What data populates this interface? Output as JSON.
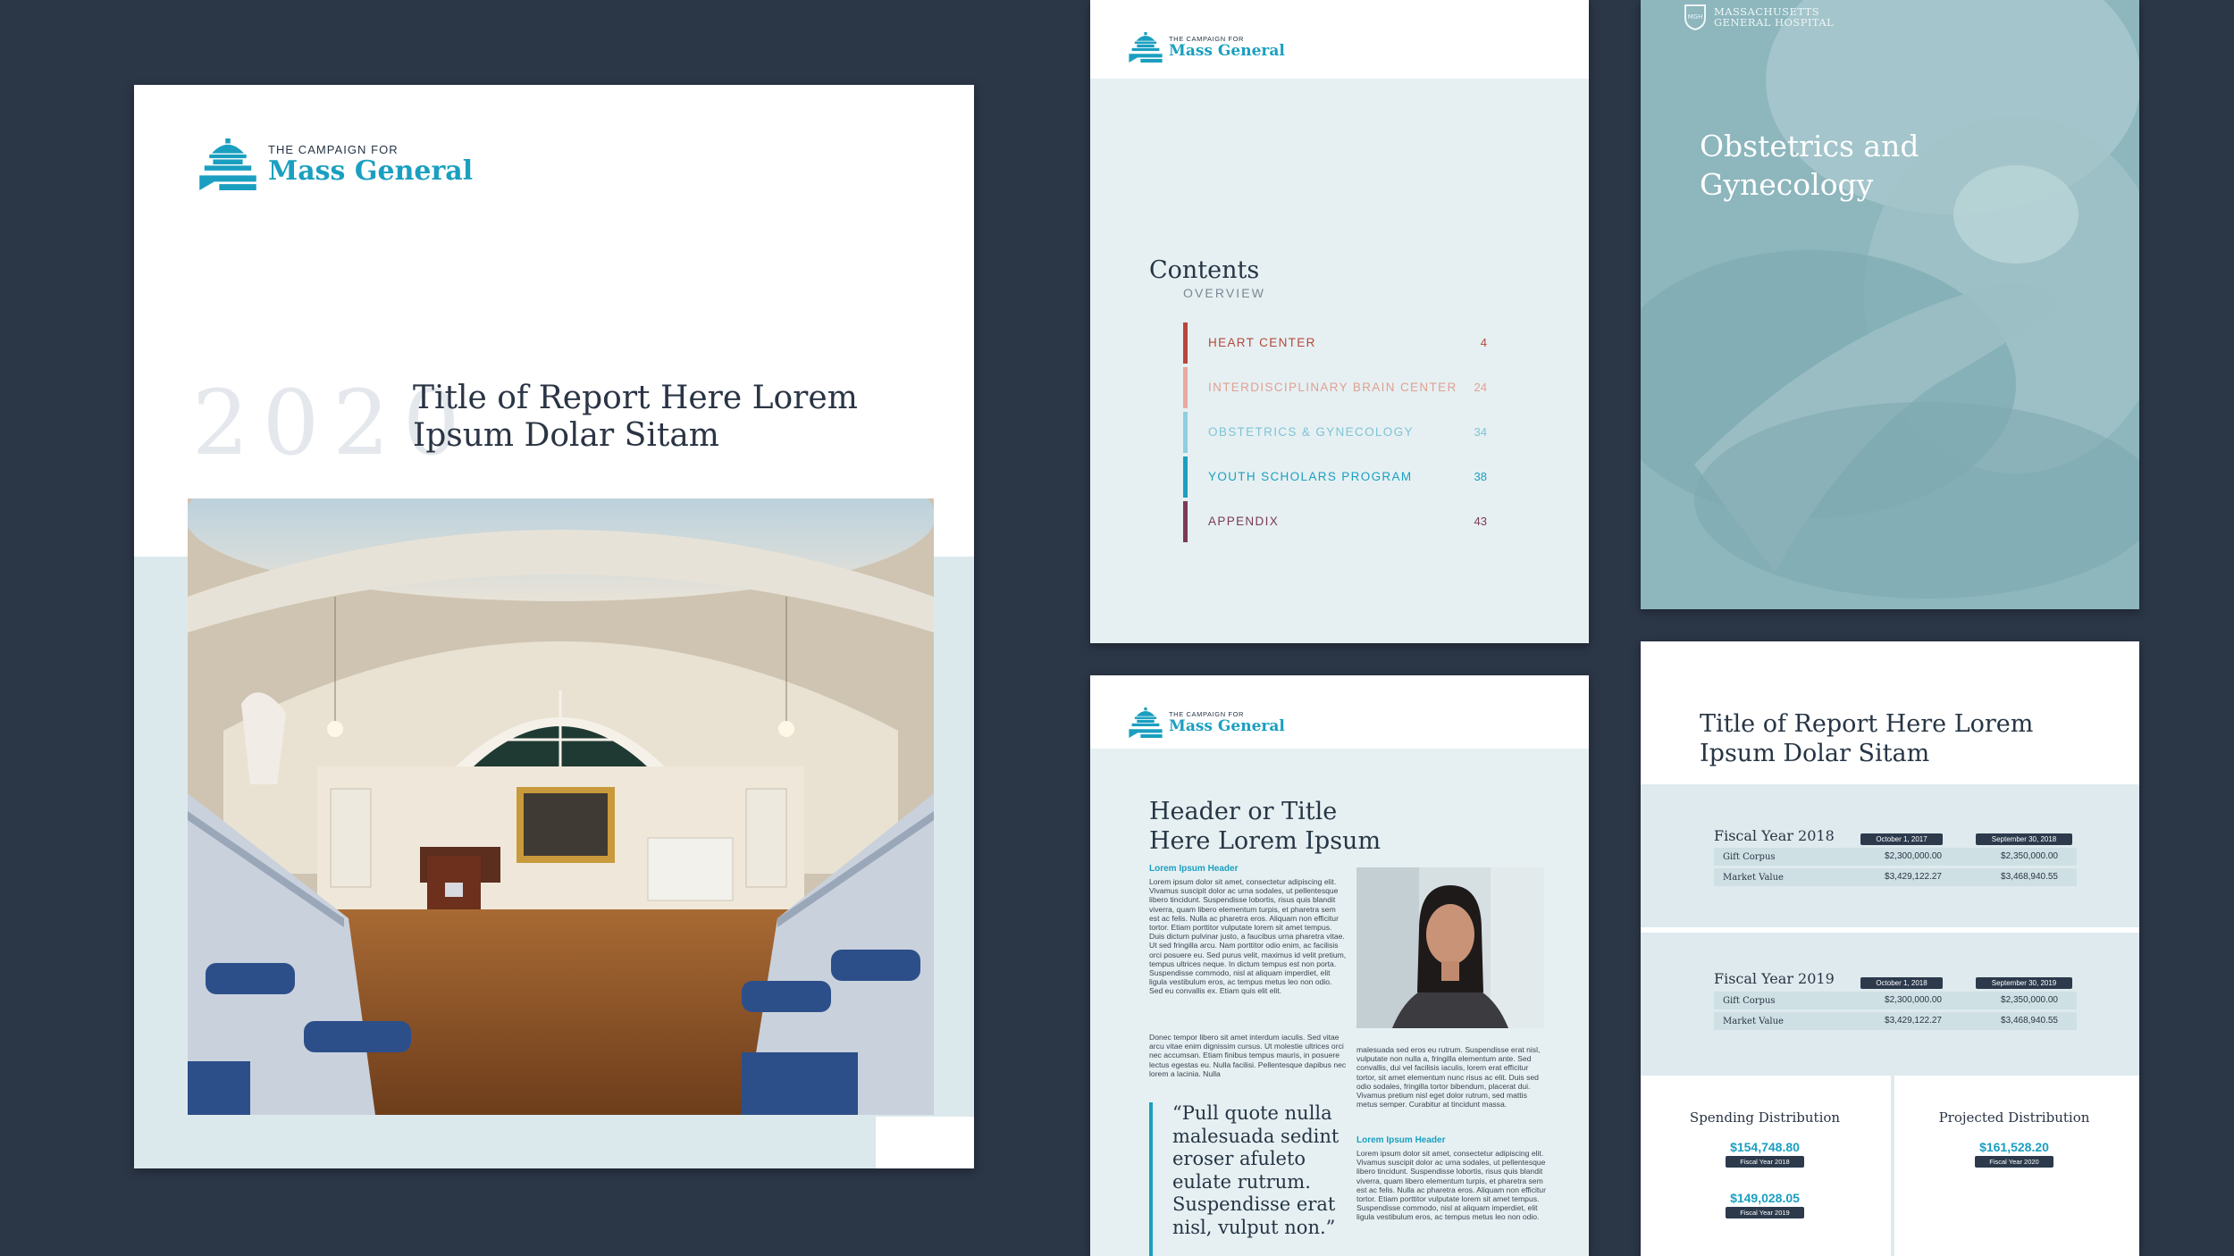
{
  "logo": {
    "small": "THE CAMPAIGN FOR",
    "big": "Mass General"
  },
  "cover": {
    "year": "2020",
    "title": "Title of Report Here Lorem Ipsum Dolar Sitam"
  },
  "contents": {
    "title": "Contents",
    "subtitle": "OVERVIEW",
    "items": [
      {
        "label": "HEART CENTER",
        "page": "4",
        "color": "#b8463a"
      },
      {
        "label": "INTERDISCIPLINARY BRAIN CENTER",
        "page": "24",
        "color": "#e8a99e"
      },
      {
        "label": "OBSTETRICS & GYNECOLOGY",
        "page": "34",
        "color": "#8ecfdf"
      },
      {
        "label": "YOUTH SCHOLARS PROGRAM",
        "page": "38",
        "color": "#1a9fc0"
      },
      {
        "label": "APPENDIX",
        "page": "43",
        "color": "#7a3a55"
      }
    ]
  },
  "obstetrics": {
    "hospital": "MASSACHUSETTS\nGENERAL HOSPITAL",
    "title": "Obstetrics and Gynecology"
  },
  "article": {
    "title": "Header or Title Here Lorem Ipsum",
    "sub1": "Lorem Ipsum Header",
    "body1": "Lorem ipsum dolor sit amet, consectetur adipiscing elit. Vivamus suscipit dolor ac urna sodales, ut pellentesque libero tincidunt. Suspendisse lobortis, risus quis blandit viverra, quam libero elementum turpis, et pharetra sem est ac felis. Nulla ac pharetra eros. Aliquam non efficitur tortor. Etiam porttitor vulputate lorem sit amet tempus. Duis dictum pulvinar justo, a faucibus urna pharetra vitae. Ut sed fringilla arcu. Nam porttitor odio enim, ac facilisis orci posuere eu. Sed purus velit, maximus id velit pretium, tempus ultrices neque. In dictum tempus est non porta. Suspendisse commodo, nisl at aliquam imperdiet, elit ligula vestibulum eros, ac tempus metus leo non odio. Sed eu convallis ex. Etiam quis elit elit.",
    "body2": "Donec tempor libero sit amet interdum iaculis. Sed vitae arcu vitae enim dignissim cursus. Ut molestie ultrices orci nec accumsan. Etiam finibus tempus mauris, in posuere lectus egestas eu. Nulla facilisi. Pellentesque dapibus nec lorem a lacinia. Nulla",
    "body3": "malesuada sed eros eu rutrum. Suspendisse erat nisl, vulputate non nulla a, fringilla elementum ante. Sed convallis, dui vel facilisis iaculis, lorem erat efficitur tortor, sit amet elementum nunc risus ac elit. Duis sed odio sodales, fringilla tortor bibendum, placerat dui. Vivamus pretium nisl eget dolor rutrum, sed mattis metus semper. Curabitur at tincidunt massa.",
    "sub2": "Lorem Ipsum Header",
    "body4": "Lorem ipsum dolor sit amet, consectetur adipiscing elit. Vivamus suscipit dolor ac urna sodales, ut pellentesque libero tincidunt. Suspendisse lobortis, risus quis blandit viverra, quam libero elementum turpis, et pharetra sem est ac felis. Nulla ac pharetra eros. Aliquam non efficitur tortor. Etiam porttitor vulputate lorem sit amet tempus. Suspendisse commodo, nisl at aliquam imperdiet, elit ligula vestibulum eros, ac tempus metus leo non odio.",
    "quote": "“Pull quote nulla malesuada sedint eroser afuleto eulate rutrum. Suspendisse erat nisl, vulput non.”"
  },
  "financial": {
    "title": "Title of Report Here Lorem Ipsum Dolar Sitam",
    "years": [
      {
        "label": "Fiscal Year 2018",
        "col1": "October 1, 2017",
        "col2": "September 30, 2018",
        "rows": [
          {
            "label": "Gift Corpus",
            "v1": "$2,300,000.00",
            "v2": "$2,350,000.00"
          },
          {
            "label": "Market Value",
            "v1": "$3,429,122.27",
            "v2": "$3,468,940.55"
          }
        ]
      },
      {
        "label": "Fiscal Year 2019",
        "col1": "October 1, 2018",
        "col2": "September 30, 2019",
        "rows": [
          {
            "label": "Gift Corpus",
            "v1": "$2,300,000.00",
            "v2": "$2,350,000.00"
          },
          {
            "label": "Market Value",
            "v1": "$3,429,122.27",
            "v2": "$3,468,940.55"
          }
        ]
      }
    ],
    "spending": {
      "title": "Spending Distribution",
      "items": [
        {
          "value": "$154,748.80",
          "label": "Fiscal Year 2018"
        },
        {
          "value": "$149,028.05",
          "label": "Fiscal Year 2019"
        }
      ]
    },
    "projected": {
      "title": "Projected Distribution",
      "items": [
        {
          "value": "$161,528.20",
          "label": "Fiscal Year 2020"
        }
      ]
    }
  }
}
